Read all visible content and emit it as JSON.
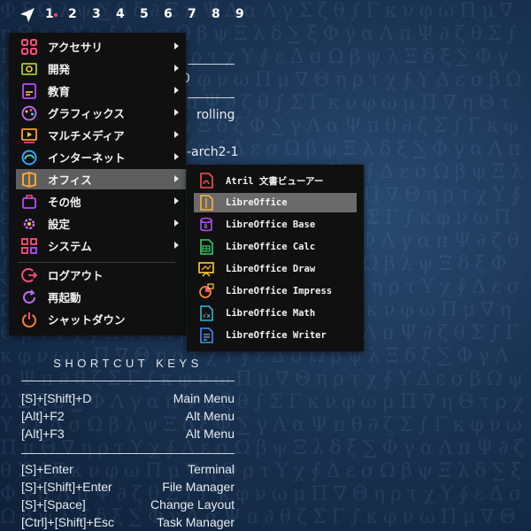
{
  "topbar": {
    "workspaces": [
      "1",
      "2",
      "3",
      "4",
      "5",
      "6",
      "7",
      "8",
      "9"
    ],
    "accent": "#ff3b6b"
  },
  "info": {
    "partial_value": "0",
    "rolling": "rolling",
    "kernel_tail": "-arch2-1"
  },
  "menu": {
    "items": [
      {
        "label": "アクセサリ",
        "icon": "accessories-icon",
        "has_submenu": true
      },
      {
        "label": "開発",
        "icon": "development-icon",
        "has_submenu": true
      },
      {
        "label": "教育",
        "icon": "education-icon",
        "has_submenu": true
      },
      {
        "label": "グラフィックス",
        "icon": "graphics-icon",
        "has_submenu": true
      },
      {
        "label": "マルチメディア",
        "icon": "multimedia-icon",
        "has_submenu": true
      },
      {
        "label": "インターネット",
        "icon": "internet-icon",
        "has_submenu": true
      },
      {
        "label": "オフィス",
        "icon": "office-icon",
        "has_submenu": true,
        "active": true
      },
      {
        "label": "その他",
        "icon": "other-icon",
        "has_submenu": true
      },
      {
        "label": "設定",
        "icon": "settings-icon",
        "has_submenu": true
      },
      {
        "label": "システム",
        "icon": "system-icon",
        "has_submenu": true
      },
      {
        "label": "ログアウト",
        "icon": "logout-icon",
        "has_submenu": false
      },
      {
        "label": "再起動",
        "icon": "reboot-icon",
        "has_submenu": false
      },
      {
        "label": "シャットダウン",
        "icon": "shutdown-icon",
        "has_submenu": false
      }
    ]
  },
  "office_submenu": {
    "items": [
      {
        "label": "Atril 文書ビューアー",
        "icon": "atril-icon"
      },
      {
        "label": "LibreOffice",
        "icon": "libreoffice-icon",
        "active": true
      },
      {
        "label": "LibreOffice Base",
        "icon": "libreoffice-base-icon"
      },
      {
        "label": "LibreOffice Calc",
        "icon": "libreoffice-calc-icon"
      },
      {
        "label": "LibreOffice Draw",
        "icon": "libreoffice-draw-icon"
      },
      {
        "label": "LibreOffice Impress",
        "icon": "libreoffice-impress-icon"
      },
      {
        "label": "LibreOffice Math",
        "icon": "libreoffice-math-icon"
      },
      {
        "label": "LibreOffice Writer",
        "icon": "libreoffice-writer-icon"
      }
    ]
  },
  "shortcuts": {
    "title": "SHORTCUT KEYS",
    "group1": [
      {
        "keys": "[S]+[Shift]+D",
        "action": "Main Menu"
      },
      {
        "keys": "[Alt]+F2",
        "action": "Alt Menu"
      },
      {
        "keys": "[Alt]+F3",
        "action": "Alt Menu"
      }
    ],
    "group2": [
      {
        "keys": "[S]+Enter",
        "action": "Terminal"
      },
      {
        "keys": "[S]+[Shift]+Enter",
        "action": "File Manager"
      },
      {
        "keys": "[S]+[Space]",
        "action": "Change Layout"
      },
      {
        "keys": "[Ctrl]+[Shift]+Esc",
        "action": "Task Manager"
      }
    ]
  }
}
